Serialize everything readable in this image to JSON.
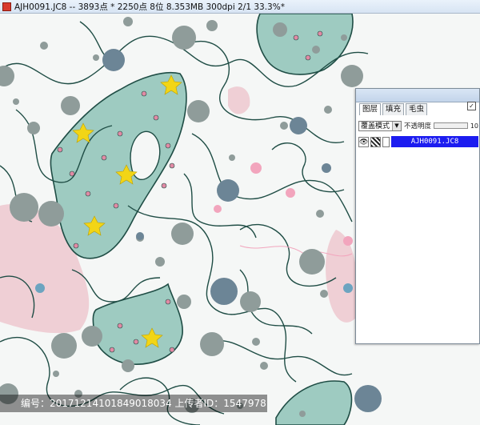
{
  "window": {
    "title": "AJH0091.JC8 -- 3893点 * 2250点 8位   8.353MB 300dpi 2/1   33.3%*"
  },
  "layers_panel": {
    "tabs": [
      {
        "label": "图层",
        "active": true
      },
      {
        "label": "填充",
        "active": false
      },
      {
        "label": "毛虫",
        "active": false
      }
    ],
    "checkbox_mark": "✓",
    "blend_mode": "覆盖模式",
    "opacity_label": "不透明度",
    "opacity_value": "10",
    "layer": {
      "name": "AJH0091.JC8",
      "visible_mark": "👁"
    }
  },
  "watermark": {
    "text": "编号：20171214101849018034 上传者ID：1547978"
  },
  "colors": {
    "teal": "#9ecbc1",
    "pink": "#efcfd5",
    "line": "#1f4d45",
    "dot_gray": "#8f9c9a",
    "dot_slate": "#6c8596",
    "yellow_flower": "#f2d516",
    "pink_dot": "#f2a5bd",
    "layer_highlight": "#1c1cf0"
  }
}
